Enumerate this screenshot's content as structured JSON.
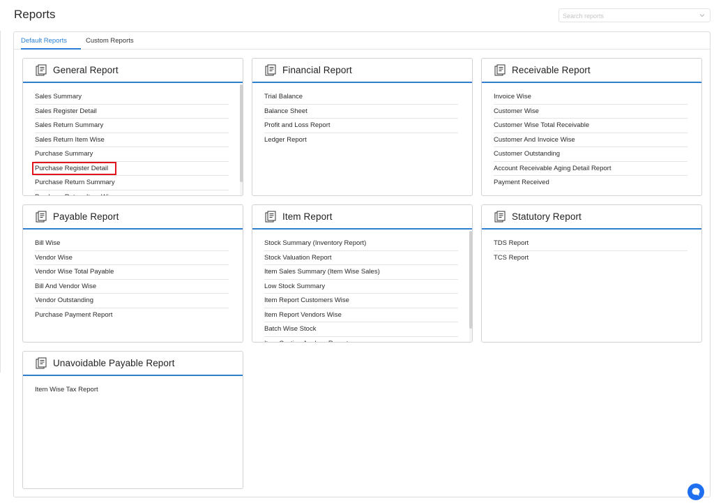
{
  "header": {
    "title": "Reports",
    "search_placeholder": "Search reports",
    "search_icon": "chevron-down-icon"
  },
  "tabs": [
    {
      "label": "Default Reports",
      "active": true
    },
    {
      "label": "Custom Reports",
      "active": false
    }
  ],
  "cards": [
    {
      "title": "General Report",
      "icon": "report-document-icon",
      "items": [
        "Sales Summary",
        "Sales Register Detail",
        "Sales Return Summary",
        "Sales Return Item Wise",
        "Purchase Summary",
        "Purchase Register Detail",
        "Purchase Return Summary",
        "Purchase Return Item Wise"
      ],
      "highlighted_item": "Purchase Register Detail"
    },
    {
      "title": "Financial Report",
      "icon": "report-document-icon",
      "items": [
        "Trial Balance",
        "Balance Sheet",
        "Profit and Loss Report",
        "Ledger Report"
      ]
    },
    {
      "title": "Receivable Report",
      "icon": "report-document-icon",
      "items": [
        "Invoice Wise",
        "Customer Wise",
        "Customer Wise Total Receivable",
        "Customer And Invoice Wise",
        "Customer Outstanding",
        "Account Receivable Aging Detail Report",
        "Payment Received"
      ]
    },
    {
      "title": "Payable Report",
      "icon": "report-document-icon",
      "items": [
        "Bill Wise",
        "Vendor Wise",
        "Vendor Wise Total Payable",
        "Bill And Vendor Wise",
        "Vendor Outstanding",
        "Purchase Payment Report"
      ]
    },
    {
      "title": "Item Report",
      "icon": "report-document-icon",
      "items": [
        "Stock Summary (Inventory Report)",
        "Stock Valuation Report",
        "Item Sales Summary (Item Wise Sales)",
        "Low Stock Summary",
        "Item Report Customers Wise",
        "Item Report Vendors Wise",
        "Batch Wise Stock",
        "Item Costing Analyze Report"
      ]
    },
    {
      "title": "Statutory Report",
      "icon": "report-document-icon",
      "items": [
        "TDS Report",
        "TCS Report"
      ]
    },
    {
      "title": "Unavoidable Payable Report",
      "icon": "report-document-icon",
      "items": [
        "Item Wise Tax Report"
      ]
    }
  ],
  "colors": {
    "accent": "#2f7fd0",
    "highlight": "#e0151b",
    "chat": "#1e6ff0"
  },
  "chat_button": {
    "icon": "chat-bubble-icon"
  }
}
